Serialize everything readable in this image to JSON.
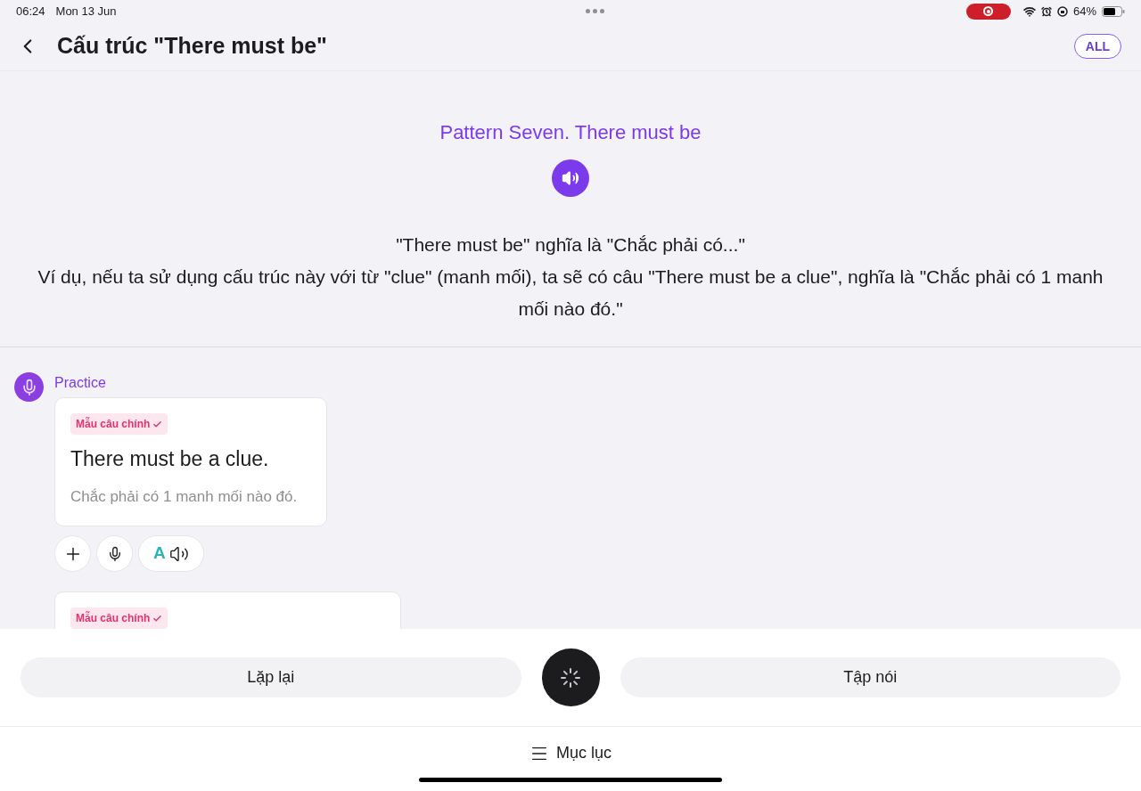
{
  "status_bar": {
    "time": "06:24",
    "date": "Mon 13 Jun",
    "battery": "64%",
    "recording": true
  },
  "header": {
    "title": "Cấu trúc \"There must be\"",
    "filter_button": "ALL"
  },
  "lesson": {
    "pattern_title": "Pattern Seven. There must be",
    "description": [
      "\"There must be\" nghĩa là \"Chắc phải có...\"",
      "Ví dụ, nếu ta sử dụng cấu trúc này với từ \"clue\" (manh mối), ta sẽ có câu \"There must be a clue\", nghĩa là \"Chắc phải có 1 manh mối nào đó.\""
    ]
  },
  "practice": {
    "label": "Practice",
    "cards": [
      {
        "tag": "Mẫu câu chính",
        "checked": true,
        "sentence": "There must be a clue.",
        "translation": "Chắc phải có 1 manh mối nào đó.",
        "action_letter": "A"
      },
      {
        "tag": "Mẫu câu chính",
        "checked": true
      }
    ]
  },
  "controls": {
    "repeat_button": "Lặp lại",
    "speak_button": "Tập nói",
    "loading": true
  },
  "bottom_nav": {
    "label": "Mục lục"
  }
}
